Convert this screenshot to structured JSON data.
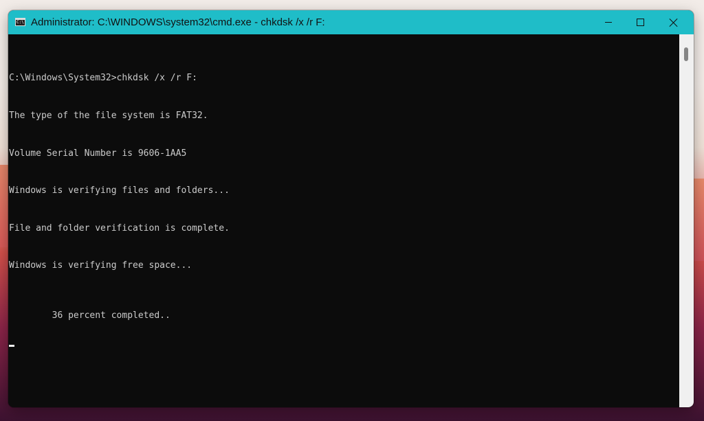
{
  "window": {
    "title": "Administrator: C:\\WINDOWS\\system32\\cmd.exe - chkdsk  /x /r F:",
    "app_icon": "C:\\",
    "accent_color": "#1fbdc8"
  },
  "icons": {
    "app": "cmd-icon",
    "minimize": "minimize-icon",
    "maximize": "maximize-icon",
    "close": "close-icon"
  },
  "console": {
    "lines": [
      "C:\\Windows\\System32>chkdsk /x /r F:",
      "The type of the file system is FAT32.",
      "Volume Serial Number is 9606-1AA5",
      "Windows is verifying files and folders...",
      "File and folder verification is complete.",
      "Windows is verifying free space...",
      "36 percent completed.."
    ],
    "background": "#0c0c0c",
    "foreground": "#cccccc"
  }
}
